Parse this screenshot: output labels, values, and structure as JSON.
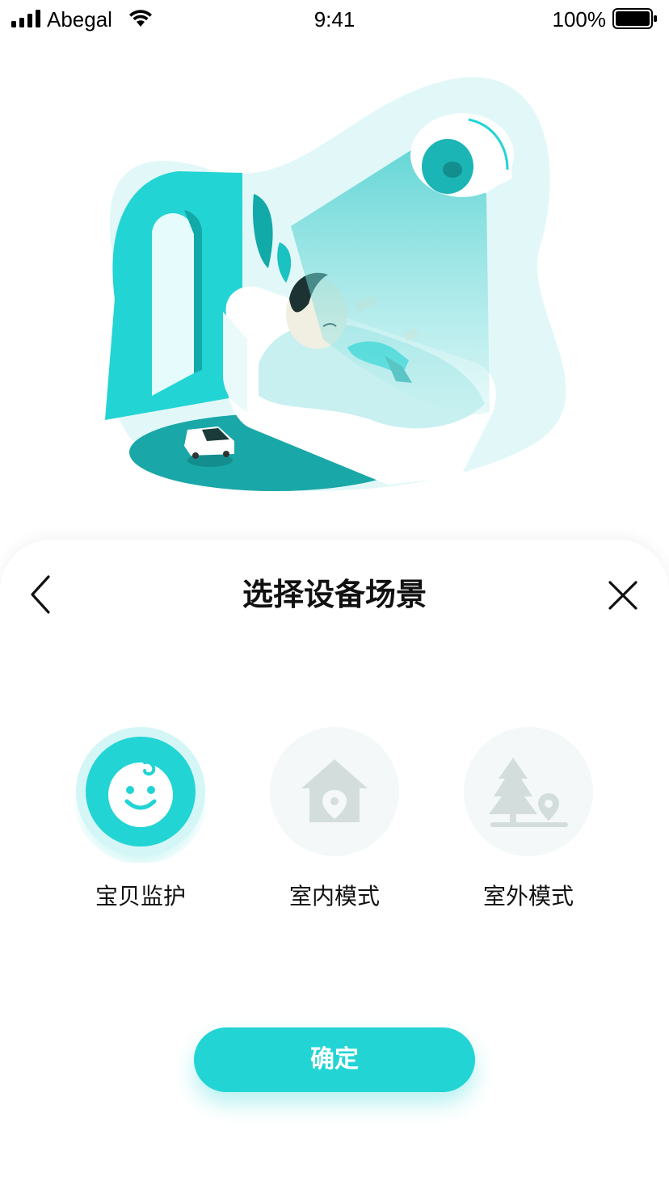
{
  "status_bar": {
    "carrier": "Abegal",
    "time": "9:41",
    "battery": "100%"
  },
  "sheet": {
    "title": "选择设备场景",
    "back_icon": "chevron-left-icon",
    "close_icon": "close-icon"
  },
  "scenes": [
    {
      "label": "宝贝监护",
      "icon": "baby-face-icon",
      "selected": true
    },
    {
      "label": "室内模式",
      "icon": "house-location-icon",
      "selected": false
    },
    {
      "label": "室外模式",
      "icon": "tree-location-icon",
      "selected": false
    }
  ],
  "confirm": {
    "label": "确定"
  },
  "colors": {
    "accent": "#22d4d4",
    "accent_light": "#d4f6f6",
    "inactive_bg": "#f5f8f9",
    "inactive_icon": "#d3dedc"
  }
}
